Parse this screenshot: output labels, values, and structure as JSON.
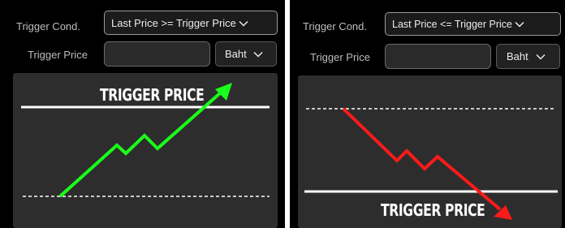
{
  "left": {
    "trigger_cond_label": "Trigger Cond.",
    "trigger_cond_value": "Last Price >= Trigger Price",
    "trigger_price_label": "Trigger Price",
    "trigger_price_value": "",
    "unit_value": "Baht",
    "chart_caption": "TRIGGER PRICE",
    "arrow_color": "#1aff1a"
  },
  "right": {
    "trigger_cond_label": "Trigger Cond.",
    "trigger_cond_value": "Last Price <= Trigger Price",
    "trigger_price_label": "Trigger Price",
    "trigger_price_value": "",
    "unit_value": "Baht",
    "chart_caption": "TRIGGER PRICE",
    "arrow_color": "#ff1a1a"
  },
  "icons": {
    "dropdown": "chevron-down-icon"
  }
}
